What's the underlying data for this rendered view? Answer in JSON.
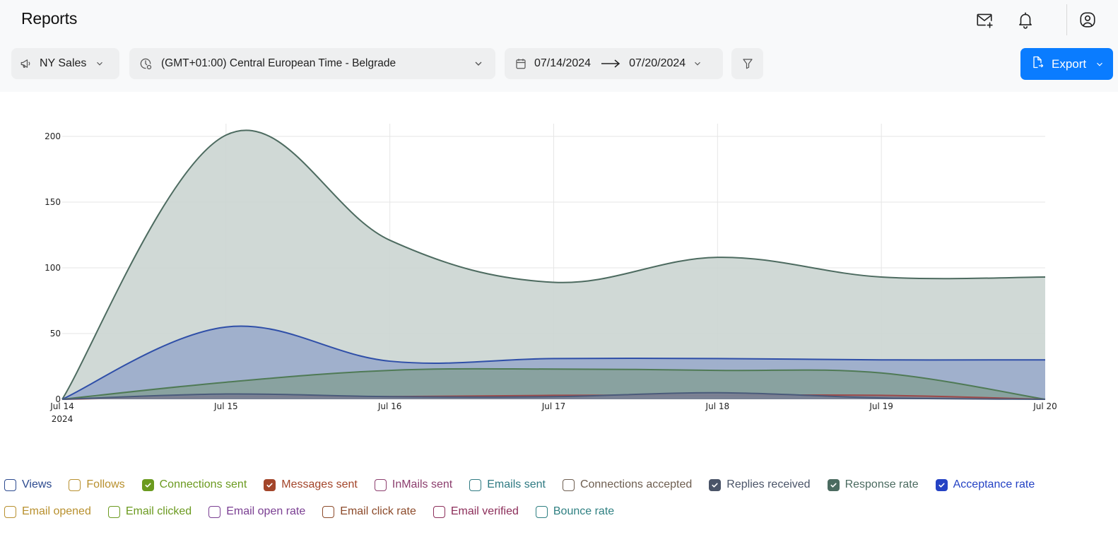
{
  "header": {
    "title": "Reports",
    "icons": [
      "mail-plus-icon",
      "bell-icon",
      "user-circle-icon"
    ]
  },
  "toolbar": {
    "campaign": {
      "icon": "megaphone-icon",
      "value": "NY Sales"
    },
    "timezone": {
      "icon": "clock-icon",
      "value": "(GMT+01:00) Central European Time - Belgrade"
    },
    "date_range": {
      "icon": "calendar-icon",
      "from": "07/14/2024",
      "to": "07/20/2024"
    },
    "filter": {
      "icon": "filter-icon"
    },
    "export": {
      "icon": "file-export-icon",
      "label": "Export",
      "color": "#0a7cff"
    }
  },
  "chart_data": {
    "type": "area",
    "title": "",
    "xlabel": "",
    "ylabel": "",
    "x": [
      "Jul 14",
      "Jul 15",
      "Jul 16",
      "Jul 17",
      "Jul 18",
      "Jul 19",
      "Jul 20"
    ],
    "x_tick_labels": [
      "Jul 14",
      "Jul 15",
      "Jul 16",
      "Jul 17",
      "Jul 18",
      "Jul 19",
      "Jul 20"
    ],
    "x_tick_sublabel": "2024",
    "y_ticks": [
      0,
      50,
      100,
      150,
      200
    ],
    "ylim": [
      0,
      210
    ],
    "grid": true,
    "curve": "smooth",
    "series": [
      {
        "name": "Response rate",
        "color": "#4d6b60",
        "fill": "#ccd6d3",
        "values": [
          0,
          201,
          121,
          89,
          108,
          93,
          93
        ]
      },
      {
        "name": "Acceptance rate",
        "color": "#2f4fa8",
        "fill": "#9badcb",
        "values": [
          0,
          55,
          29,
          31,
          31,
          30,
          30
        ]
      },
      {
        "name": "Connections sent",
        "color": "#4f7a55",
        "fill": "#87a19c",
        "values": [
          0,
          13,
          22,
          23,
          22,
          20,
          0
        ]
      },
      {
        "name": "Messages sent",
        "color": "#9c4a4a",
        "fill": "#7f7f8f",
        "values": [
          0,
          2,
          2,
          3,
          3,
          3,
          0
        ]
      },
      {
        "name": "Replies received",
        "color": "#4a5a7a",
        "fill": "#7a8296",
        "values": [
          0,
          4,
          2,
          2,
          5,
          1,
          0
        ]
      }
    ]
  },
  "legend": {
    "rows": [
      [
        {
          "label": "Views",
          "color": "#2c4a8f",
          "checked": false
        },
        {
          "label": "Follows",
          "color": "#b8902e",
          "checked": false
        },
        {
          "label": "Connections sent",
          "color": "#6b9a1f",
          "checked": true
        },
        {
          "label": "Messages sent",
          "color": "#a3452a",
          "checked": true
        },
        {
          "label": "InMails sent",
          "color": "#8c3e6e",
          "checked": false
        },
        {
          "label": "Emails sent",
          "color": "#2f7a82",
          "checked": false
        },
        {
          "label": "Connections accepted",
          "color": "#6e5e50",
          "checked": false
        },
        {
          "label": "Replies received",
          "color": "#4a5468",
          "checked": true
        },
        {
          "label": "Response rate",
          "color": "#4b6b60",
          "checked": true
        },
        {
          "label": "Acceptance rate",
          "color": "#2442c4",
          "checked": true
        }
      ],
      [
        {
          "label": "Email opened",
          "color": "#b8902e",
          "checked": false
        },
        {
          "label": "Email clicked",
          "color": "#6b9a1f",
          "checked": false
        },
        {
          "label": "Email open rate",
          "color": "#7a3e92",
          "checked": false
        },
        {
          "label": "Email click rate",
          "color": "#8c4a2a",
          "checked": false
        },
        {
          "label": "Email verified",
          "color": "#8c2e5a",
          "checked": false
        },
        {
          "label": "Bounce rate",
          "color": "#2f8082",
          "checked": false
        }
      ]
    ]
  }
}
